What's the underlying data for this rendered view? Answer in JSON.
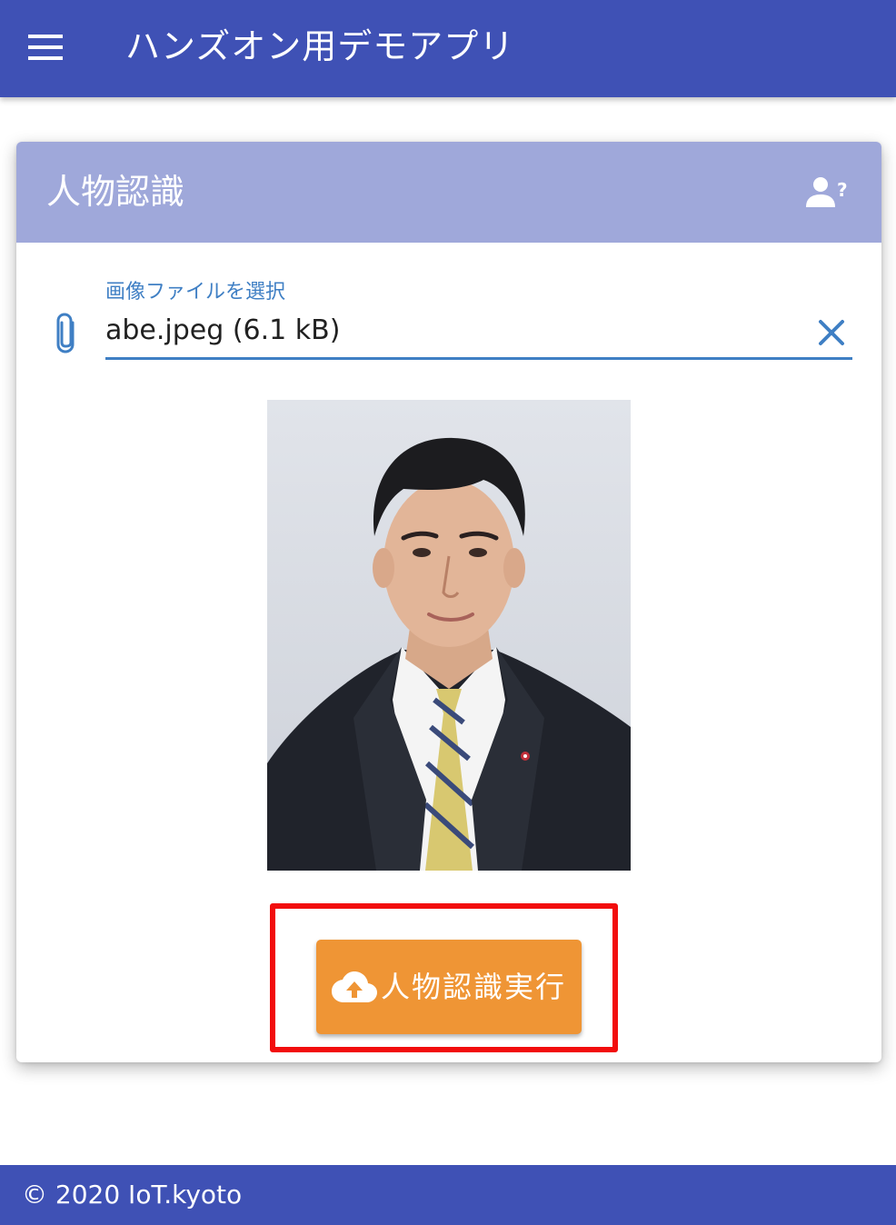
{
  "app_bar": {
    "title": "ハンズオン用デモアプリ",
    "menu_icon": "menu-icon",
    "background": "#3f51b5"
  },
  "card": {
    "title": "人物認識",
    "header_icon": "person-question-icon",
    "header_background": "#9fa8da",
    "file_input": {
      "label": "画像ファイルを選択",
      "value": "abe.jpeg (6.1 kB)",
      "prepend_icon": "paperclip-icon",
      "clear_icon": "close-icon",
      "accent": "#3f7fc4"
    },
    "preview_image": "portrait-photo",
    "run_button": {
      "label": "人物認識実行",
      "icon": "cloud-upload-icon",
      "color": "#ef9535"
    },
    "highlight_color": "#f20d0d"
  },
  "footer": {
    "text": "© 2020 IoT.kyoto"
  }
}
